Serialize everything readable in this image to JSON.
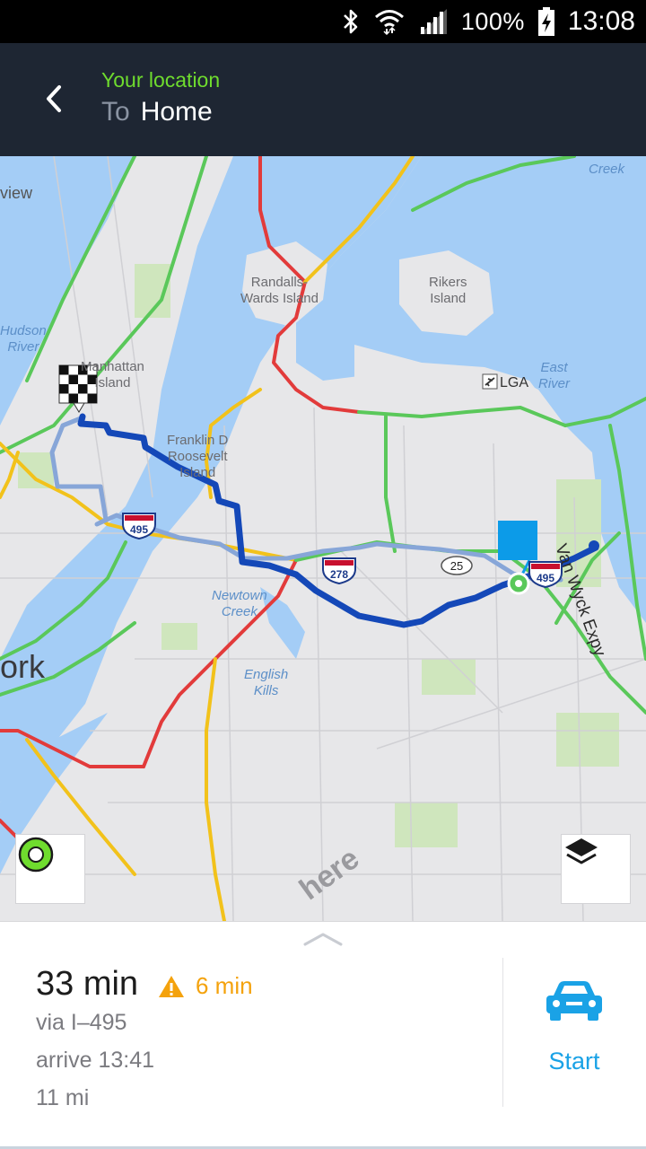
{
  "status_bar": {
    "icons": [
      "bluetooth-icon",
      "wifi-icon",
      "signal-icon",
      "battery-charging-icon"
    ],
    "battery": "100%",
    "time": "13:08"
  },
  "header": {
    "origin": "Your location",
    "dest_prefix": "To",
    "destination": "Home"
  },
  "map": {
    "labels": {
      "view": "view",
      "hudson": "Hudson\nRiver",
      "manhattan": "Manhattan\nIsland",
      "randalls": "Randalls-\nWards Island",
      "rikers": "Rikers\nIsland",
      "lga": "LGA",
      "east_river": "East\nRiver",
      "roosevelt": "Franklin D\nRoosevelt\nIsland",
      "newtown": "Newtown\nCreek",
      "english_kills": "English\nKills",
      "york": "ork",
      "creek": "Creek",
      "van_wyck": "Van Wyck Expy",
      "brand": "here"
    },
    "shields": [
      "495",
      "278",
      "25",
      "495"
    ],
    "colors": {
      "route_primary": "#1448b8",
      "route_alt": "#87a6d8",
      "water": "#a4cdf6",
      "park": "#cfe6bd",
      "traffic_green": "#5ac85a",
      "traffic_yellow": "#f2c21b",
      "traffic_red": "#e23b3b"
    }
  },
  "route": {
    "duration": "33 min",
    "delay": "6 min",
    "via": "via I–495",
    "arrive": "arrive 13:41",
    "distance": "11 mi",
    "start_label": "Start"
  },
  "accent": "#1aa2e6"
}
